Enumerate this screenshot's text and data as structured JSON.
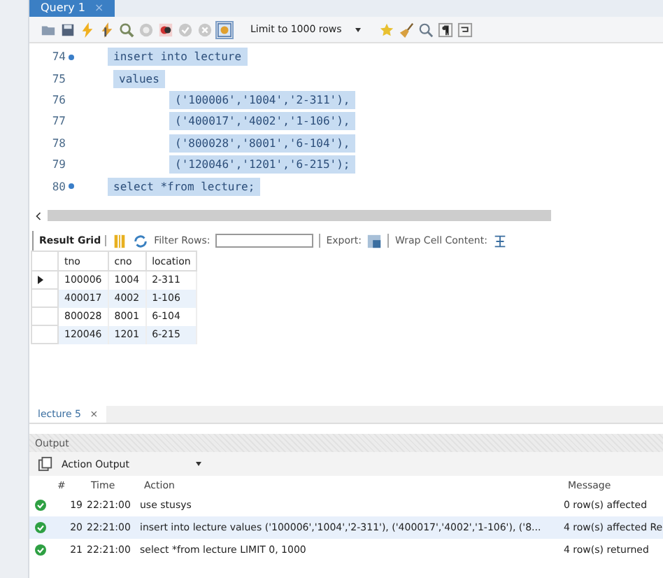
{
  "editor_tab": {
    "title": "Query 1",
    "close": "×"
  },
  "toolbar": {
    "limit": "Limit to 1000 rows"
  },
  "code_lines": [
    {
      "number": "74",
      "marker": true,
      "text": "insert into lecture",
      "selected": true,
      "kind": "statement"
    },
    {
      "number": "75",
      "marker": false,
      "text": "values",
      "selected": true,
      "kind": "clause"
    },
    {
      "number": "76",
      "marker": false,
      "text": "('100006','1004','2-311'),",
      "selected": true,
      "kind": "tuple"
    },
    {
      "number": "77",
      "marker": false,
      "text": "('400017','4002','1-106'),",
      "selected": true,
      "kind": "tuple"
    },
    {
      "number": "78",
      "marker": false,
      "text": "('800028','8001','6-104'),",
      "selected": true,
      "kind": "tuple"
    },
    {
      "number": "79",
      "marker": false,
      "text": "('120046','1201','6-215');",
      "selected": true,
      "kind": "tuple"
    },
    {
      "number": "80",
      "marker": true,
      "text": "select *from lecture;",
      "selected": true,
      "kind": "statement"
    }
  ],
  "result_toolbar": {
    "grid_label": "Result Grid",
    "filter_label": "Filter Rows:",
    "export_label": "Export:",
    "wrap_label": "Wrap Cell Content:"
  },
  "result_grid": {
    "columns": [
      "tno",
      "cno",
      "location"
    ],
    "rows": [
      {
        "current": true,
        "cells": [
          "100006",
          "1004",
          "2-311"
        ]
      },
      {
        "current": false,
        "cells": [
          "400017",
          "4002",
          "1-106"
        ]
      },
      {
        "current": false,
        "cells": [
          "800028",
          "8001",
          "6-104"
        ]
      },
      {
        "current": false,
        "cells": [
          "120046",
          "1201",
          "6-215"
        ]
      }
    ]
  },
  "result_tab": {
    "title": "lecture 5",
    "close": "×"
  },
  "output": {
    "title": "Output",
    "selector": "Action Output",
    "columns": [
      "#",
      "Time",
      "Action",
      "Message"
    ],
    "rows": [
      {
        "number": "19",
        "time": "22:21:00",
        "action": "use stusys",
        "message": "0 row(s) affected",
        "selected": false
      },
      {
        "number": "20",
        "time": "22:21:00",
        "action": "insert into lecture  values ('100006','1004','2-311'),    ('400017','4002','1-106'),    ('8...",
        "message": "4 row(s) affected Re",
        "selected": true
      },
      {
        "number": "21",
        "time": "22:21:00",
        "action": "select *from lecture LIMIT 0, 1000",
        "message": "4 row(s) returned",
        "selected": false
      }
    ]
  }
}
